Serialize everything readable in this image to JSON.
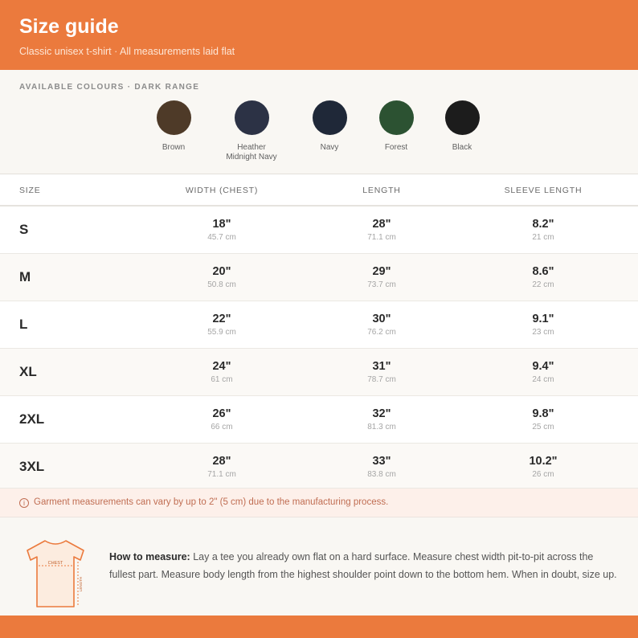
{
  "header": {
    "title": "Size guide",
    "subtitle": "Classic unisex t-shirt · All measurements laid flat"
  },
  "colours": {
    "label": "AVAILABLE COLOURS · DARK RANGE",
    "swatches": [
      {
        "name": "Brown",
        "color": "#4e3a28"
      },
      {
        "name": "Heather Midnight Navy",
        "color": "#2c3245"
      },
      {
        "name": "Navy",
        "color": "#1f2838"
      },
      {
        "name": "Forest",
        "color": "#2c5232"
      },
      {
        "name": "Black",
        "color": "#1c1c1c"
      }
    ]
  },
  "table": {
    "headers": [
      "SIZE",
      "WIDTH (CHEST)",
      "LENGTH",
      "SLEEVE LENGTH"
    ],
    "rows": [
      {
        "size": "S",
        "width_in": "18\"",
        "width_cm": "45.7 cm",
        "length_in": "28\"",
        "length_cm": "71.1 cm",
        "sleeve_in": "8.2\"",
        "sleeve_cm": "21 cm"
      },
      {
        "size": "M",
        "width_in": "20\"",
        "width_cm": "50.8 cm",
        "length_in": "29\"",
        "length_cm": "73.7 cm",
        "sleeve_in": "8.6\"",
        "sleeve_cm": "22 cm"
      },
      {
        "size": "L",
        "width_in": "22\"",
        "width_cm": "55.9 cm",
        "length_in": "30\"",
        "length_cm": "76.2 cm",
        "sleeve_in": "9.1\"",
        "sleeve_cm": "23 cm"
      },
      {
        "size": "XL",
        "width_in": "24\"",
        "width_cm": "61 cm",
        "length_in": "31\"",
        "length_cm": "78.7 cm",
        "sleeve_in": "9.4\"",
        "sleeve_cm": "24 cm"
      },
      {
        "size": "2XL",
        "width_in": "26\"",
        "width_cm": "66 cm",
        "length_in": "32\"",
        "length_cm": "81.3 cm",
        "sleeve_in": "9.8\"",
        "sleeve_cm": "25 cm"
      },
      {
        "size": "3XL",
        "width_in": "28\"",
        "width_cm": "71.1 cm",
        "length_in": "33\"",
        "length_cm": "83.8 cm",
        "sleeve_in": "10.2\"",
        "sleeve_cm": "26 cm"
      }
    ]
  },
  "note": {
    "icon": "info-icon",
    "text": "Garment measurements can vary by up to 2\" (5 cm) due to the manufacturing process."
  },
  "howto": {
    "illustration_labels": {
      "chest": "CHEST",
      "length": "LENGTH"
    },
    "heading": "How to measure:",
    "body": " Lay a tee you already own flat on a hard surface. Measure chest width pit-to-pit across the fullest part. Measure body length from the highest shoulder point down to the bottom hem. When in doubt, size up."
  },
  "theme": {
    "accent": "#eb7a3d"
  }
}
